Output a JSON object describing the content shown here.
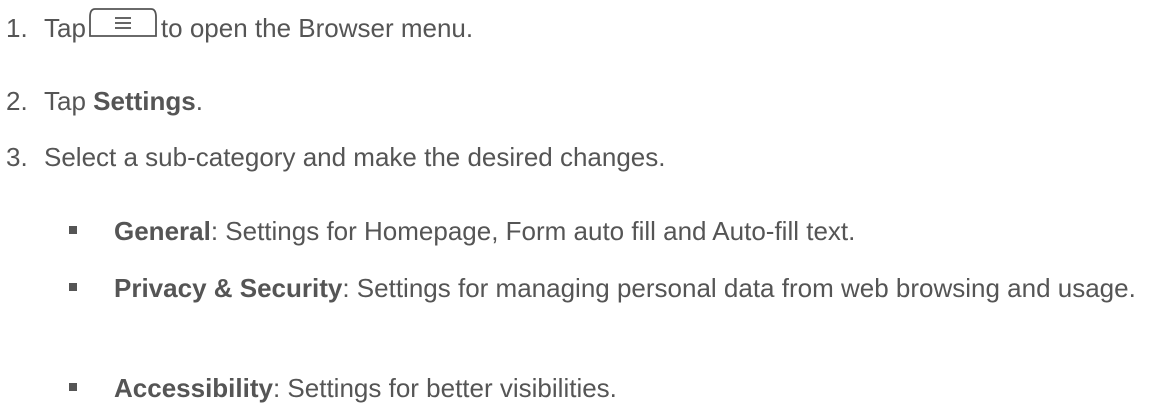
{
  "steps": [
    {
      "num": "1.",
      "before": "Tap",
      "icon": "menu-key-icon",
      "after": "to open the Browser menu."
    },
    {
      "num": "2.",
      "before": "Tap ",
      "bold": "Settings",
      "after": "."
    },
    {
      "num": "3.",
      "text": "Select a sub-category and make the desired changes."
    }
  ],
  "bullets": [
    {
      "title": "General",
      "desc": ": Settings for Homepage, Form auto fill and Auto-fill text."
    },
    {
      "title": "Privacy & Security",
      "desc": ": Settings for managing personal data from web browsing and usage."
    },
    {
      "title": "Accessibility",
      "desc": ": Settings for better visibilities."
    }
  ],
  "colors": {
    "text": "#555555",
    "icon_stroke": "#555555"
  }
}
